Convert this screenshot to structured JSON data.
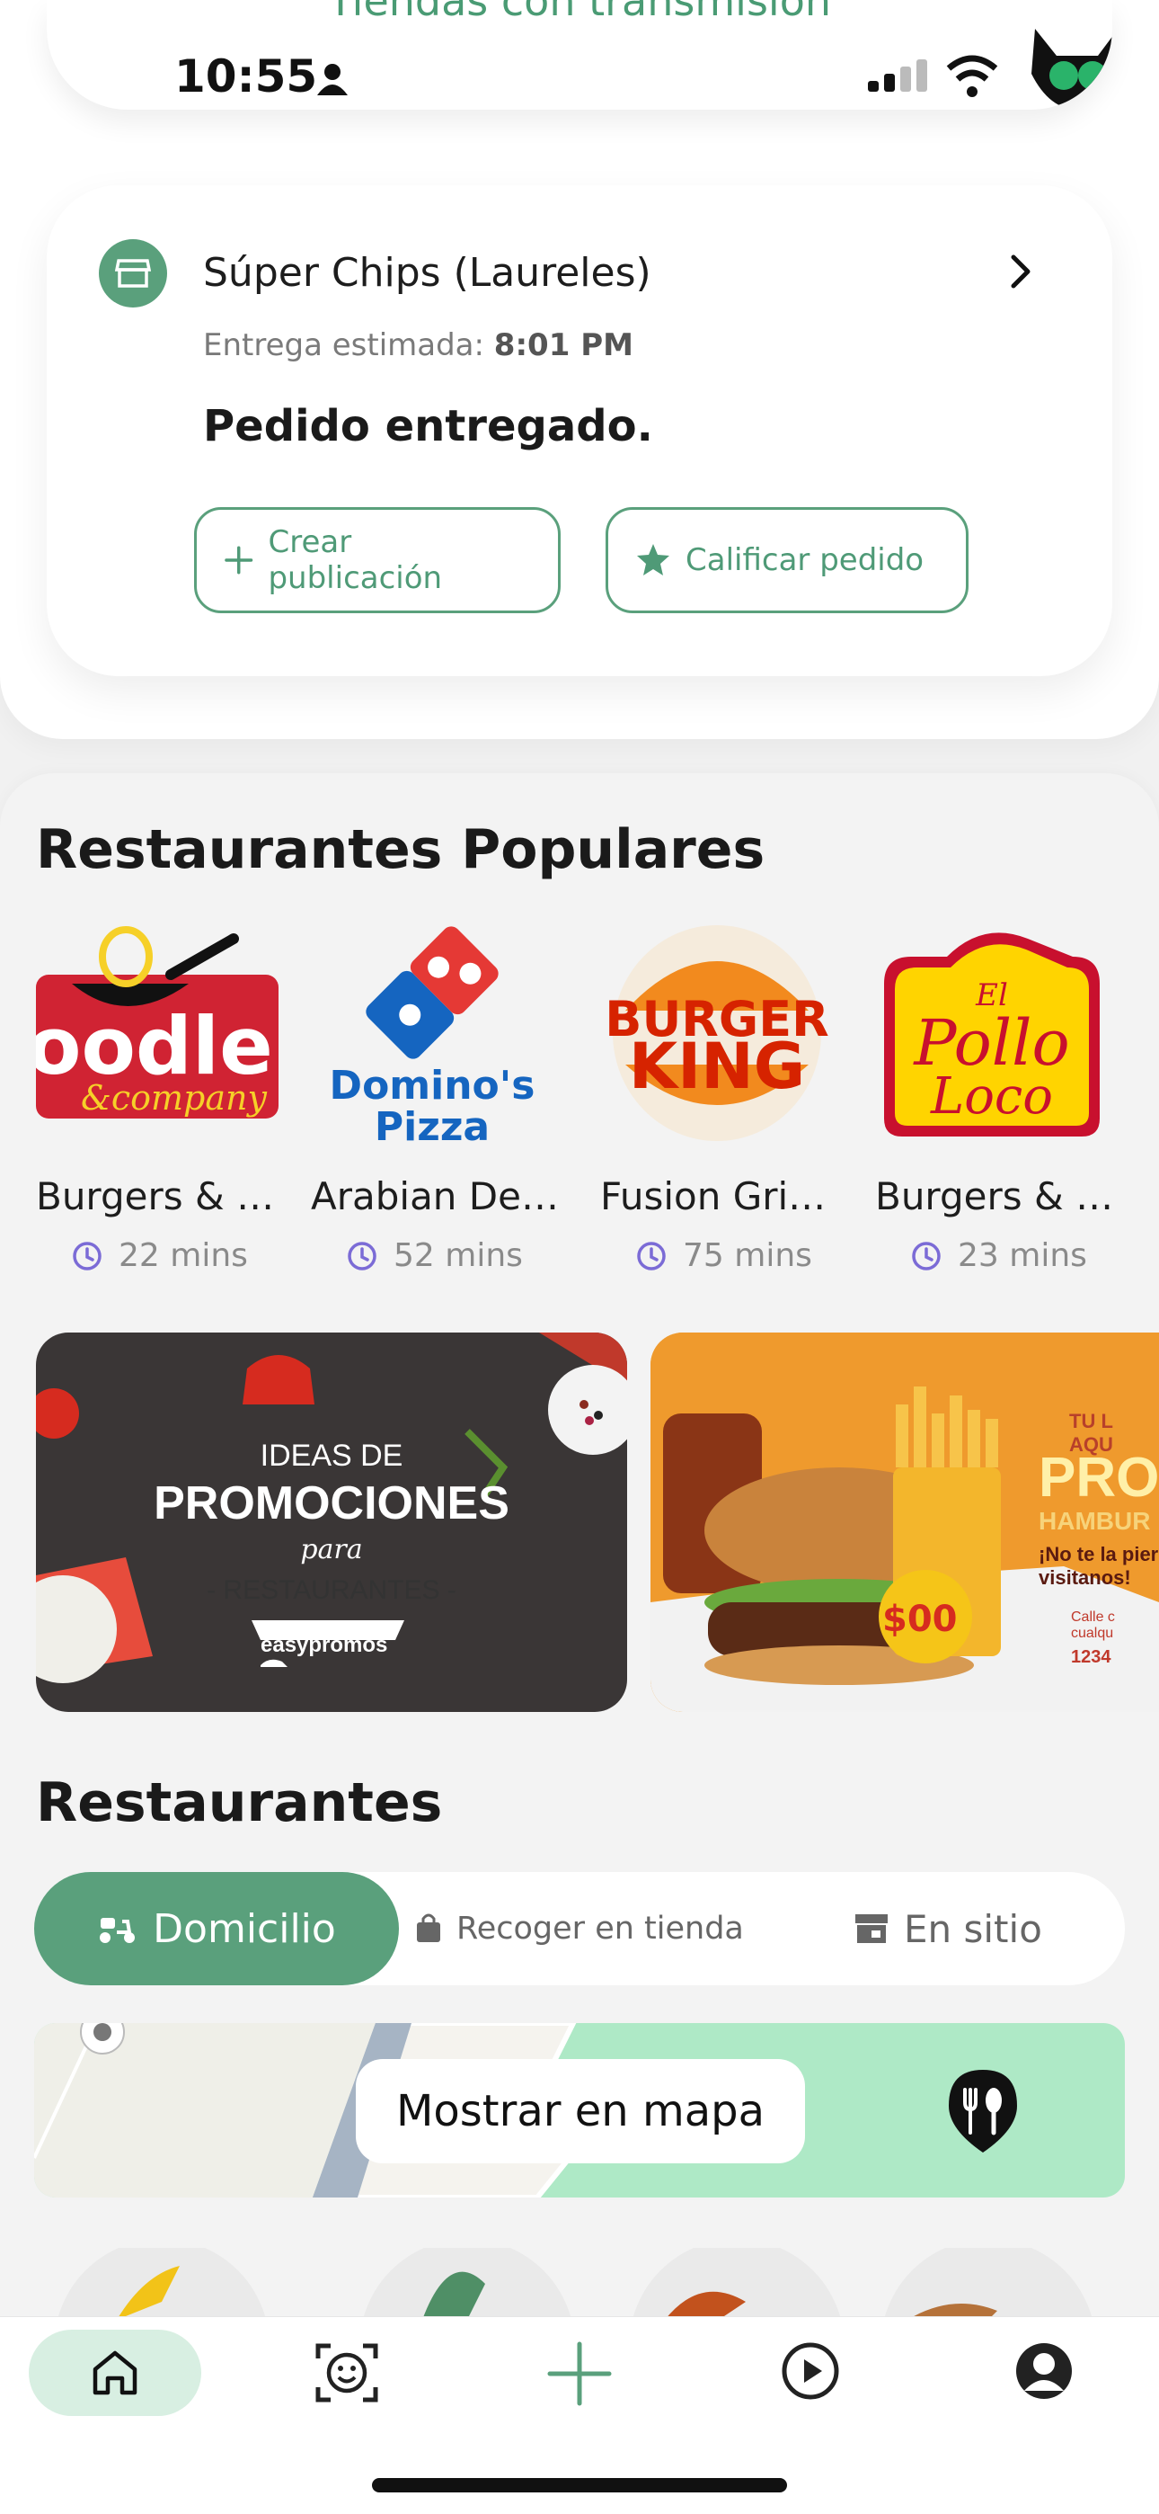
{
  "status_bar": {
    "time": "10:55"
  },
  "banner": {
    "title": "Tiendas con transmisión"
  },
  "order": {
    "store_name": "Súper Chips (Laureles)",
    "eta_label": "Entrega estimada:",
    "eta_time": "8:01 PM",
    "status": "Pedido entregado.",
    "btn_create": "Crear publicación",
    "btn_rate": "Calificar pedido"
  },
  "popular": {
    "title": "Restaurantes Populares",
    "items": [
      {
        "name": "Burgers & …",
        "time": "22 mins",
        "logo_text": "oodle &company"
      },
      {
        "name": "Arabian De…",
        "time": "52 mins",
        "logo_text": "Domino's Pizza"
      },
      {
        "name": "Fusion Gri…",
        "time": "75 mins",
        "logo_text": "BURGER KING"
      },
      {
        "name": "Burgers & …",
        "time": "23 mins",
        "logo_text": "El Pollo Loco"
      }
    ]
  },
  "promos": [
    {
      "line1": "IDEAS DE",
      "line2": "PROMOCIONES",
      "line3": "para",
      "line4": "- RESTAURANTES -",
      "brand": "easypromos"
    },
    {
      "tag": "TU L AQU",
      "headline": "PRO",
      "sub": "HAMBUR",
      "note": "¡No te la pier visitanos!",
      "price": "$00",
      "addr1": "Calle c cualqu",
      "phone": "1234"
    }
  ],
  "restaurants": {
    "title": "Restaurantes",
    "tabs": [
      "Domicilio",
      "Recoger en tienda",
      "En sitio"
    ],
    "map_button": "Mostrar en mapa"
  },
  "colors": {
    "accent": "#5aa07c",
    "accent_light": "#d8efe2",
    "map_green": "#aee9c6"
  }
}
